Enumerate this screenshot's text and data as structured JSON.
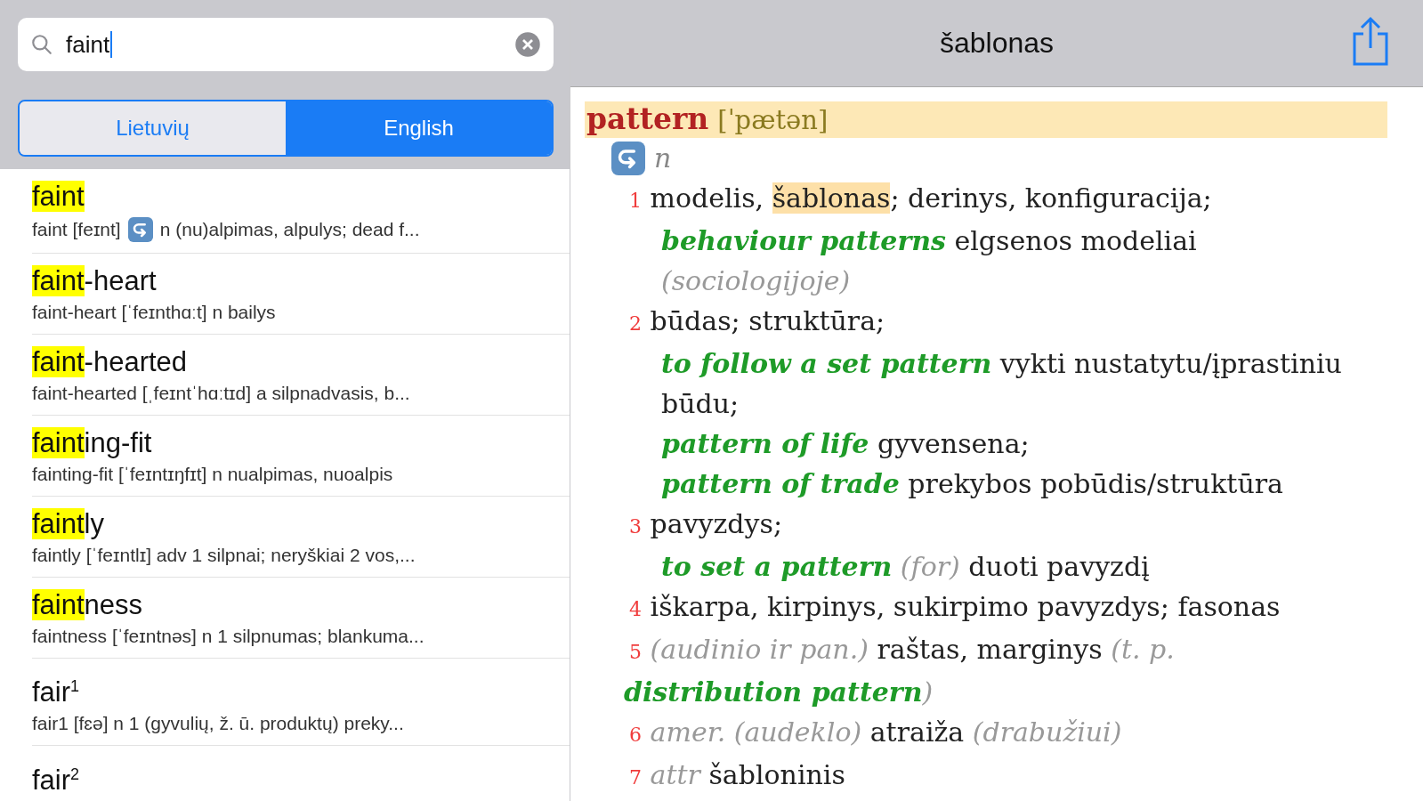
{
  "search": {
    "value": "faint"
  },
  "segments": [
    {
      "label": "Lietuvių",
      "selected": false
    },
    {
      "label": "English",
      "selected": true
    }
  ],
  "results": [
    {
      "match": "faint",
      "preview": [
        {
          "kind": "text",
          "text": "faint [feɪnt]"
        },
        {
          "kind": "icon"
        },
        {
          "kind": "text",
          "text": "n (nu)alpimas, alpulys; dead f..."
        }
      ]
    },
    {
      "match": "faint",
      "rest": "-heart",
      "preview": [
        {
          "kind": "text",
          "text": "faint-heart [ˈfeɪnthɑːt] n bailys"
        }
      ]
    },
    {
      "match": "faint",
      "rest": "-hearted",
      "preview": [
        {
          "kind": "text",
          "text": "faint-hearted [ˌfeɪntˈhɑːtɪd] a silpnadvasis, b..."
        }
      ]
    },
    {
      "match": "faint",
      "rest": "ing-fit",
      "preview": [
        {
          "kind": "text",
          "text": "fainting-fit [ˈfeɪntɪŋfɪt] n nualpimas, nuoalpis"
        }
      ]
    },
    {
      "match": "faint",
      "rest": "ly",
      "preview": [
        {
          "kind": "text",
          "text": "faintly [ˈfeɪntlɪ] adv 1 silpnai; neryškiai 2 vos,..."
        }
      ]
    },
    {
      "match": "faint",
      "rest": "ness",
      "preview": [
        {
          "kind": "text",
          "text": "faintness [ˈfeɪntnəs] n 1 silpnumas; blankuma..."
        }
      ]
    },
    {
      "rest": "fair$^{1}$",
      "preview": [
        {
          "kind": "text",
          "text": "fair1 [fɛə] n 1 (gyvulių, ž. ū. produktų) preky..."
        }
      ]
    },
    {
      "rest": "fair$^{2}$"
    }
  ],
  "entry": {
    "title": "šablonas",
    "headword": "pattern",
    "transcription": "[ˈpætən]",
    "pos": "n",
    "lines": [
      {
        "kind": "sense",
        "segments": [
          {
            "kind": "num",
            "text": "1"
          },
          {
            "kind": "text",
            "text": "modelis,"
          },
          {
            "kind": "mark",
            "text": "šablonas"
          },
          {
            "kind": "text",
            "text": "; derinys, konfiguracija;"
          }
        ]
      },
      {
        "kind": "example",
        "segments": [
          {
            "kind": "phrase",
            "text": "behaviour patterns"
          },
          {
            "kind": "text",
            "text": "elgsenos modeliai"
          },
          {
            "kind": "note",
            "text": "(sociologijoje)"
          }
        ]
      },
      {
        "kind": "sense",
        "segments": [
          {
            "kind": "num",
            "text": "2"
          },
          {
            "kind": "text",
            "text": "būdas; struktūra;"
          }
        ]
      },
      {
        "kind": "example",
        "segments": [
          {
            "kind": "phrase",
            "text": "to follow a set pattern"
          },
          {
            "kind": "text",
            "text": "vykti nustatytu/įprastiniu"
          },
          {
            "kind": "text",
            "text": "būdu;"
          }
        ]
      },
      {
        "kind": "example",
        "segments": [
          {
            "kind": "phrase",
            "text": "pattern of life"
          },
          {
            "kind": "text",
            "text": "gyvensena;"
          }
        ]
      },
      {
        "kind": "example",
        "segments": [
          {
            "kind": "phrase",
            "text": "pattern of trade"
          },
          {
            "kind": "text",
            "text": "prekybos pobūdis/struktūra"
          }
        ]
      },
      {
        "kind": "sense",
        "segments": [
          {
            "kind": "num",
            "text": "3"
          },
          {
            "kind": "text",
            "text": "pavyzdys;"
          }
        ]
      },
      {
        "kind": "example",
        "segments": [
          {
            "kind": "phrase",
            "text": "to set a pattern"
          },
          {
            "kind": "note",
            "text": "(for)"
          },
          {
            "kind": "text",
            "text": "duoti pavyzdį"
          }
        ]
      },
      {
        "kind": "sense",
        "segments": [
          {
            "kind": "num",
            "text": "4"
          },
          {
            "kind": "text",
            "text": "iškarpa, kirpinys, sukirpimo pavyzdys; fasonas"
          }
        ]
      },
      {
        "kind": "sense",
        "segments": [
          {
            "kind": "num",
            "text": "5"
          },
          {
            "kind": "note",
            "text": "(audinio ir pan.)"
          },
          {
            "kind": "text",
            "text": "raštas, marginys"
          },
          {
            "kind": "note",
            "text": "(t. p."
          },
          {
            "kind": "phrase",
            "text": "distribution pattern"
          },
          {
            "kind": "note",
            "text": ")"
          }
        ]
      },
      {
        "kind": "sense",
        "segments": [
          {
            "kind": "num",
            "text": "6"
          },
          {
            "kind": "note",
            "text": "amer. (audeklo)"
          },
          {
            "kind": "text",
            "text": "atraiža"
          },
          {
            "kind": "note",
            "text": "(drabužiui)"
          }
        ]
      },
      {
        "kind": "sense",
        "segments": [
          {
            "kind": "num",
            "text": "7"
          },
          {
            "kind": "note",
            "text": "attr"
          },
          {
            "kind": "text",
            "text": "šabloninis"
          }
        ]
      }
    ]
  }
}
